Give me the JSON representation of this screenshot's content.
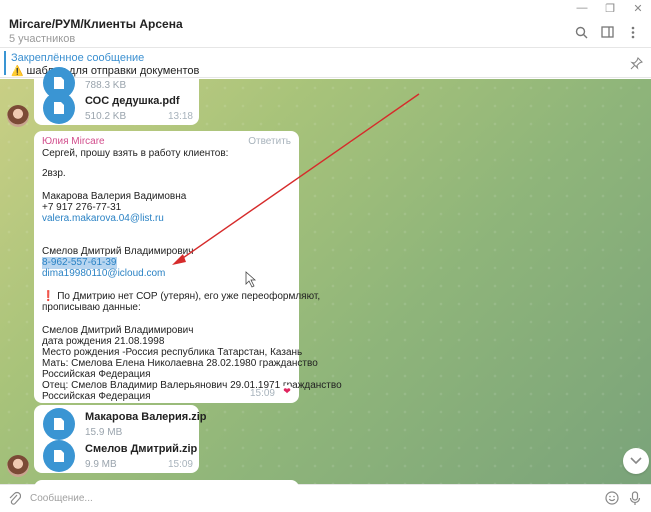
{
  "window": {
    "controls": [
      "—",
      "❐",
      "✕"
    ]
  },
  "header": {
    "title": "Mircare/РУМ/Клиенты Арсена",
    "subtitle": "5 участников"
  },
  "pinned": {
    "title": "Закреплённое сообщение",
    "text": "шаблон для отправки документов"
  },
  "messages": {
    "top_bubble": {
      "file1": {
        "name": "",
        "size": "788.3 KB"
      },
      "file2": {
        "name": "СОС дедушка.pdf",
        "size": "510.2 KB"
      },
      "time": "13:18"
    },
    "text_bubble": {
      "sender": "Юлия Mircare",
      "reply_label": "Ответить",
      "lines": [
        "Сергей, прошу взять в работу клиентов:",
        "",
        "2взр.",
        "",
        "Макарова Валерия Вадимовна",
        "+7 917 276-77-31",
        "valera.makarova.04@list.ru",
        "",
        "",
        "Смелов Дмитрий Владимирович",
        "8-962-557-61-39",
        "dima19980110@icloud.com",
        "",
        "По Дмитрию нет СОР (утерян), его  уже переоформляют,",
        "прописываю данные:",
        "",
        "Смелов Дмитрий Владимирович",
        "дата рождения 21.08.1998",
        "Место рождения -Россия республика Татарстан, Казань",
        "Мать: Смелова Елена Николаевна 28.02.1980  гражданство",
        "Российская Федерация",
        "Отец: Смелов Владимир Валерьянович 29.01.1971 гражданство",
        "Российская Федерация"
      ],
      "time": "15:09"
    },
    "bottom_bubble": {
      "file1": {
        "name": "Макарова Валерия.zip",
        "size": "15.9 MB"
      },
      "file2": {
        "name": "Смелов Дмитрий.zip",
        "size": "9.9 MB"
      },
      "time": "15:09"
    }
  },
  "composer": {
    "placeholder": "Сообщение..."
  },
  "colors": {
    "accent": "#3a95d3",
    "annotation_arrow": "#d62b2b",
    "sender": "#d24d8c"
  }
}
